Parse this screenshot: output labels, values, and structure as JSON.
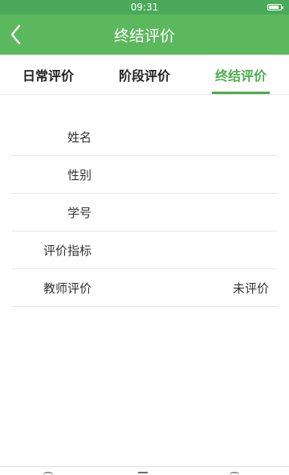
{
  "status_bar": {
    "time": "09:31",
    "battery_level": 0.85
  },
  "header": {
    "title": "终结评价",
    "back_icon": "chevron-left-icon"
  },
  "tabs": [
    {
      "label": "日常评价",
      "active": false
    },
    {
      "label": "阶段评价",
      "active": false
    },
    {
      "label": "终结评价",
      "active": true
    }
  ],
  "form": {
    "rows": [
      {
        "label": "姓名",
        "value": ""
      },
      {
        "label": "性别",
        "value": ""
      },
      {
        "label": "学号",
        "value": ""
      },
      {
        "label": "评价指标",
        "value": ""
      },
      {
        "label": "教师评价",
        "value": "未评价"
      }
    ]
  },
  "bottom_nav": {
    "icons": [
      "home-icon",
      "grid-icon",
      "user-icon"
    ]
  },
  "colors": {
    "status_bar": "#4aa95a",
    "app_bar": "#5cb85c",
    "accent": "#4cae4c"
  }
}
